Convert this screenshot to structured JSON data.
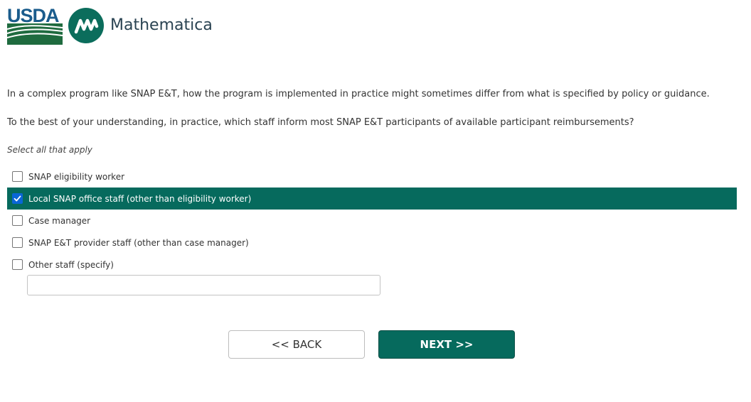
{
  "header": {
    "usda_logo_text": "USDA",
    "brand_name": "Mathematica"
  },
  "question": {
    "intro": "In a complex program like SNAP E&T, how the program is implemented in practice might sometimes differ from what is specified by policy or guidance.",
    "text": "To the best of your understanding, in practice, which staff inform most SNAP E&T participants of available participant reimbursements?",
    "instruction": "Select all that apply"
  },
  "options": [
    {
      "label": "SNAP eligibility worker",
      "checked": false
    },
    {
      "label": "Local SNAP office staff (other than eligibility worker)",
      "checked": true
    },
    {
      "label": "Case manager",
      "checked": false
    },
    {
      "label": "SNAP E&T provider staff (other than case manager)",
      "checked": false
    },
    {
      "label": "Other staff (specify)",
      "checked": false
    }
  ],
  "specify_input": {
    "value": "",
    "placeholder": ""
  },
  "nav": {
    "back_label": "<< BACK",
    "next_label": "NEXT >>"
  },
  "colors": {
    "selected_row": "#066a5d",
    "next_button": "#066a5d",
    "usda_blue": "#1a5c8c",
    "usda_green": "#1f6b3f",
    "checkbox_checked": "#0a66d6"
  }
}
